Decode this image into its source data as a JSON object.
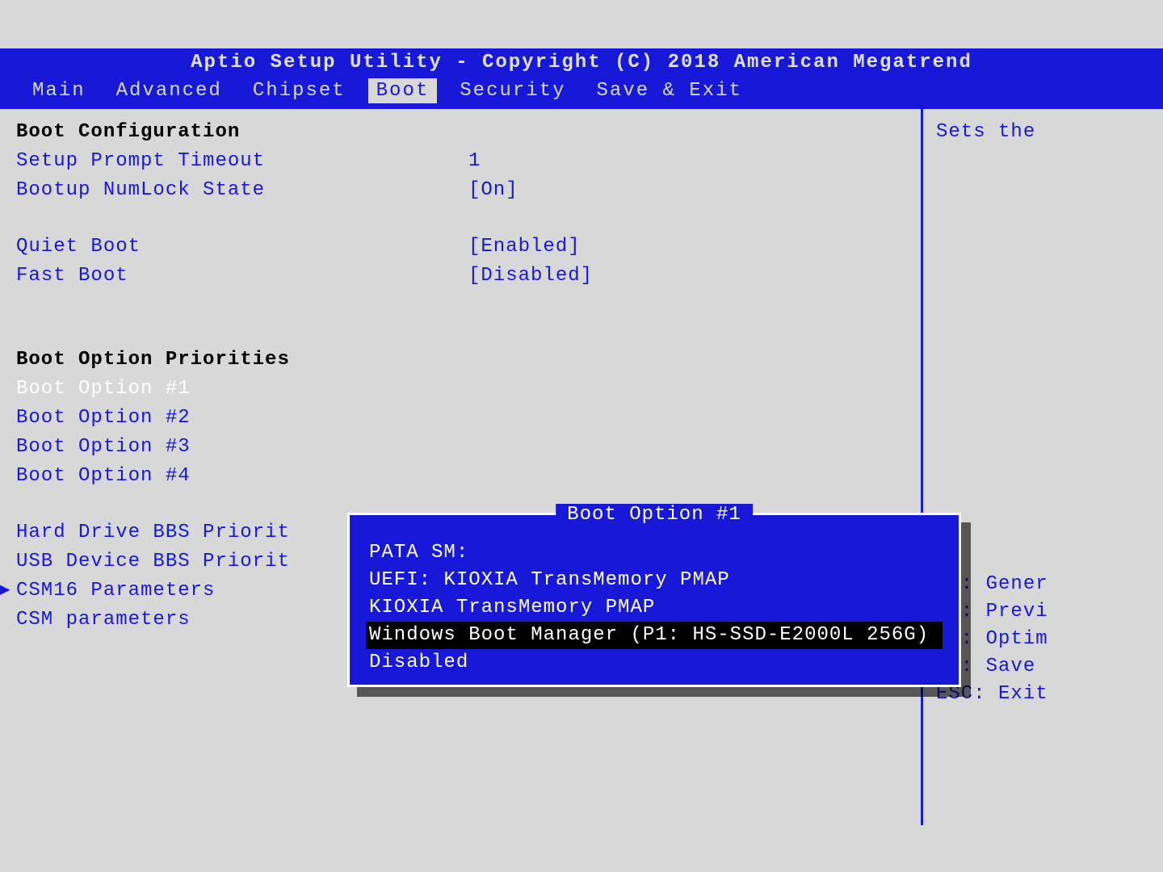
{
  "header": {
    "title": "Aptio Setup Utility - Copyright (C) 2018 American Megatrend",
    "tabs": [
      "Main",
      "Advanced",
      "Chipset",
      "Boot",
      "Security",
      "Save & Exit"
    ],
    "active_tab_index": 3
  },
  "left": {
    "section1_heading": "Boot Configuration",
    "setup_prompt_label": "Setup Prompt Timeout",
    "setup_prompt_value": "1",
    "numlock_label": "Bootup NumLock State",
    "numlock_value": "[On]",
    "quiet_boot_label": "Quiet Boot",
    "quiet_boot_value": "[Enabled]",
    "fast_boot_label": "Fast Boot",
    "fast_boot_value": "[Disabled]",
    "section2_heading": "Boot Option Priorities",
    "bo1_label": "Boot Option #1",
    "bo2_label": "Boot Option #2",
    "bo3_label": "Boot Option #3",
    "bo4_label": "Boot Option #4",
    "hd_bbs_label": "Hard Drive BBS Priorit",
    "usb_bbs_label": "USB Device BBS Priorit",
    "csm16_label": "CSM16 Parameters",
    "csm_label": "CSM parameters"
  },
  "right": {
    "description": "Sets the",
    "help": {
      "f1": "F1: Gener",
      "f2": "F2: Previ",
      "f3": "F3: Optim",
      "f4": "F4: Save",
      "esc": "ESC: Exit"
    }
  },
  "popup": {
    "title": "Boot Option #1",
    "options": [
      "PATA  SM:",
      "UEFI: KIOXIA TransMemory PMAP",
      "KIOXIA TransMemory PMAP",
      "Windows Boot Manager (P1: HS-SSD-E2000L 256G)",
      "Disabled"
    ],
    "highlighted_index": 3
  }
}
